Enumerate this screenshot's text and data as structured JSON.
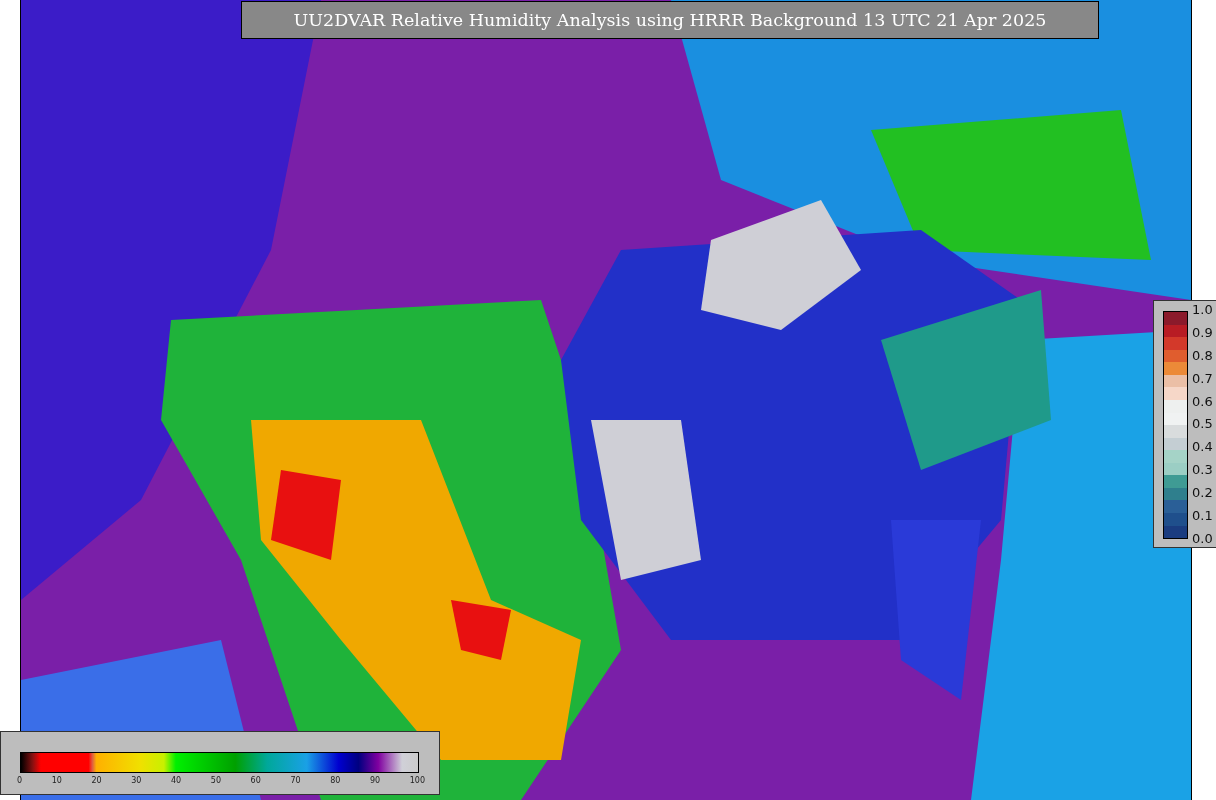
{
  "title": "UU2DVAR Relative Humidity Analysis using HRRR Background 13 UTC 21 Apr 2025",
  "humidity_colorbar": {
    "ticks": [
      "0",
      "10",
      "20",
      "30",
      "40",
      "50",
      "60",
      "70",
      "80",
      "90",
      "100"
    ]
  },
  "observation_colorbar": {
    "ticks": [
      "1.0",
      "0.9",
      "0.8",
      "0.7",
      "0.6",
      "0.5",
      "0.4",
      "0.3",
      "0.2",
      "0.1",
      "0.0"
    ]
  }
}
